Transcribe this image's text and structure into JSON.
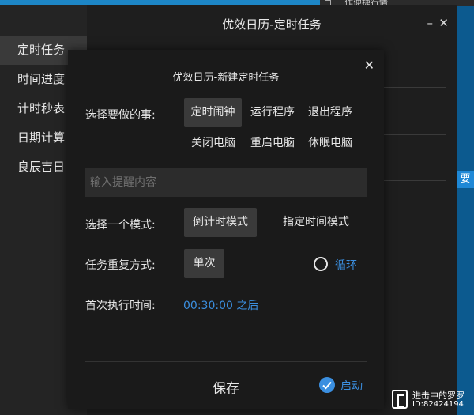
{
  "background_window": {
    "title_fragment": "工作便捷行情"
  },
  "main_window": {
    "title": "优效日历-定时任务",
    "minimize_glyph": "–",
    "close_glyph": "✕",
    "right_sliver_text": "要"
  },
  "sidebar": {
    "items": [
      {
        "label": "定时任务",
        "active": true
      },
      {
        "label": "时间进度",
        "active": false
      },
      {
        "label": "计时秒表",
        "active": false
      },
      {
        "label": "日期计算",
        "active": false
      },
      {
        "label": "良辰吉日",
        "active": false
      }
    ]
  },
  "dialog": {
    "title": "优效日历-新建定时任务",
    "close_glyph": "✕",
    "task_label": "选择要做的事:",
    "task_options": [
      "定时闹钟",
      "运行程序",
      "退出程序",
      "关闭电脑",
      "重启电脑",
      "休眠电脑"
    ],
    "task_selected": "定时闹钟",
    "reminder_placeholder": "输入提醒内容",
    "reminder_value": "",
    "mode_label": "选择一个模式:",
    "mode_options": [
      "倒计时模式",
      "指定时间模式"
    ],
    "mode_selected": "倒计时模式",
    "repeat_label": "任务重复方式:",
    "repeat_single": "单次",
    "repeat_loop": "循环",
    "repeat_selected": "单次",
    "first_time_label": "首次执行时间:",
    "first_time_value": "00:30:00 之后",
    "save_label": "保存",
    "start_label": "启动",
    "start_checked": true
  },
  "colors": {
    "accent": "#3b8fe0",
    "dialog_bg": "#1a1a1a",
    "selected_bg": "#3a3a3a"
  },
  "watermark": {
    "line1": "进击中的罗罗",
    "line2": "ID:82424194"
  }
}
